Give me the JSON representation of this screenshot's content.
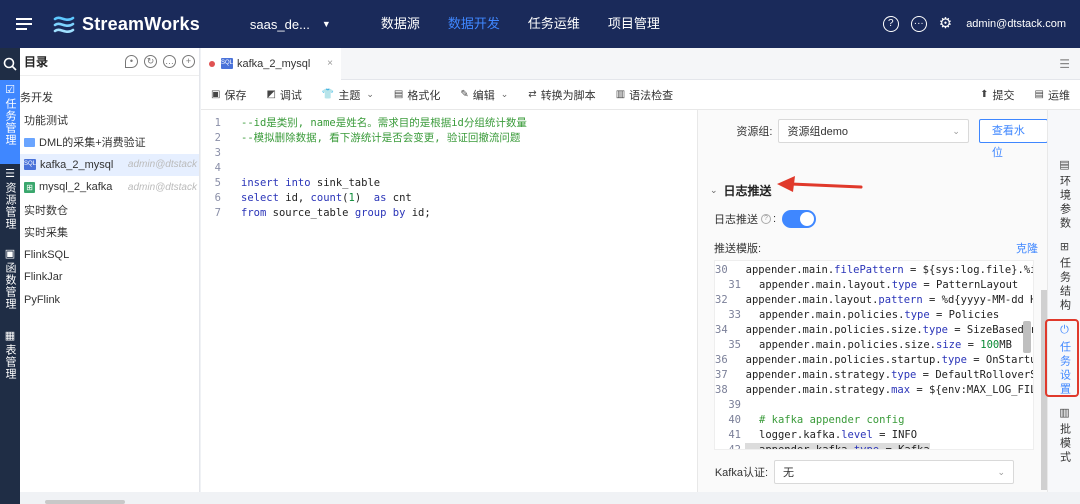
{
  "topbar": {
    "brand": "StreamWorks",
    "project": "saas_de...",
    "nav": [
      "数据源",
      "数据开发",
      "任务运维",
      "项目管理"
    ],
    "active_nav": 1,
    "user": "admin@dtstack.com",
    "help_glyph": "?",
    "chat_glyph": "···"
  },
  "rail": {
    "items": [
      "任务管理",
      "资源管理",
      "函数管理",
      "表管理"
    ]
  },
  "tree": {
    "title": "目录",
    "rows": [
      {
        "label": "务开发",
        "indent": false
      },
      {
        "label": "功能测试",
        "indent": true
      },
      {
        "label": "DML的采集+消费验证",
        "indent": true,
        "icon": "folder"
      },
      {
        "label": "kafka_2_mysql",
        "indent": true,
        "icon": "sql",
        "owner": "admin@dtstack",
        "selected": true
      },
      {
        "label": "mysql_2_kafka",
        "indent": true,
        "icon": "green",
        "owner": "admin@dtstack"
      },
      {
        "label": "实时数仓",
        "indent": true
      },
      {
        "label": "实时采集",
        "indent": true
      },
      {
        "label": "FlinkSQL",
        "indent": true
      },
      {
        "label": "FlinkJar",
        "indent": true
      },
      {
        "label": "PyFlink",
        "indent": true
      }
    ]
  },
  "tab": {
    "label": "kafka_2_mysql",
    "badge": "SQL",
    "close": "×"
  },
  "toolbar": {
    "save": "保存",
    "debug": "调试",
    "theme": "主题",
    "format": "格式化",
    "edit": "编辑",
    "to_script": "转换为脚本",
    "syntax_check": "语法检查",
    "submit": "提交",
    "ops": "运维"
  },
  "editor": {
    "lines": [
      {
        "n": "1",
        "html": "<span class=\"cm\">--id是类别, name是姓名。需求目的是根据id分组统计数量</span>"
      },
      {
        "n": "2",
        "html": "<span class=\"cm\">--模拟删除数据, 看下游统计是否会变更, 验证回撤流问题</span>"
      },
      {
        "n": "3",
        "html": ""
      },
      {
        "n": "4",
        "html": ""
      },
      {
        "n": "5",
        "html": "<span class=\"kw\">insert into</span> sink_table"
      },
      {
        "n": "6",
        "html": "<span class=\"kw\">select</span> id, <span class=\"kw\">count</span>(<span class=\"num\">1</span>)  <span class=\"kw\">as</span> cnt"
      },
      {
        "n": "7",
        "html": "<span class=\"kw\">from</span> source_table <span class=\"kw\">group by</span> id;"
      }
    ]
  },
  "settings": {
    "resource_label": "资源组:",
    "resource_value": "资源组demo",
    "watermark_btn": "查看水位",
    "section_title": "日志推送",
    "push_label": "日志推送",
    "push_enabled": true,
    "template_label": "推送模版:",
    "restore": "克隆",
    "template_lines": [
      {
        "n": "30",
        "html": "appender.main.<span class=\"k\">filePattern</span> = ${sys:log.file}.%i"
      },
      {
        "n": "31",
        "html": "appender.main.layout.<span class=\"k\">type</span> = PatternLayout"
      },
      {
        "n": "32",
        "html": "appender.main.layout.<span class=\"k\">pattern</span> = %d{yyyy-MM-dd HH"
      },
      {
        "n": "33",
        "html": "appender.main.policies.<span class=\"k\">type</span> = Policies"
      },
      {
        "n": "34",
        "html": "appender.main.policies.size.<span class=\"k\">type</span> = SizeBasedTr"
      },
      {
        "n": "35",
        "html": "appender.main.policies.size.<span class=\"k\">size</span> = <span class=\"n\">100</span>MB"
      },
      {
        "n": "36",
        "html": "appender.main.policies.startup.<span class=\"k\">type</span> = OnStartu"
      },
      {
        "n": "37",
        "html": "appender.main.strategy.<span class=\"k\">type</span> = DefaultRolloverS"
      },
      {
        "n": "38",
        "html": "appender.main.strategy.<span class=\"k\">max</span> = ${env:MAX_LOG_FIL"
      },
      {
        "n": "39",
        "html": ""
      },
      {
        "n": "40",
        "html": "<span class=\"c\"># kafka appender config</span>"
      },
      {
        "n": "41",
        "html": "logger.kafka.<span class=\"k\">level</span> = INFO"
      },
      {
        "n": "42",
        "html": "appender.kafka.<span class=\"k\">type</span> = Kafka",
        "hl": true
      }
    ],
    "kafka_label": "Kafka认证:",
    "kafka_value": "无"
  },
  "vtabs": {
    "items": [
      "环境参数",
      "任务结构",
      "任务设置",
      "批模式"
    ],
    "active": 2
  },
  "colors": {
    "nav_bg": "#1a2a5a",
    "accent": "#3f87ff",
    "annotation": "#e0392b"
  }
}
